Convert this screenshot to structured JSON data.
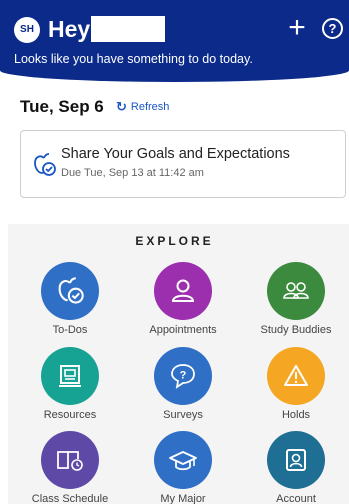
{
  "header": {
    "avatar_initials": "SH",
    "greeting": "Hey",
    "subtitle": "Looks like you have something to do today.",
    "add_icon": "plus-icon",
    "help_icon": "help-icon",
    "bg_color": "#0b2a8a"
  },
  "date_row": {
    "date": "Tue, Sep 6",
    "refresh_label": "Refresh",
    "refresh_icon": "refresh-icon"
  },
  "task": {
    "title": "Share Your Goals and Expectations",
    "due": "Due Tue, Sep 13 at 11:42 am",
    "icon": "apple-check-icon"
  },
  "explore": {
    "title": "EXPLORE",
    "tiles": [
      {
        "label": "To-Dos",
        "icon": "apple-check-icon",
        "color": "#2f6fc6"
      },
      {
        "label": "Appointments",
        "icon": "person-icon",
        "color": "#9b2fae"
      },
      {
        "label": "Study Buddies",
        "icon": "people-icon",
        "color": "#3c8a3e"
      },
      {
        "label": "Resources",
        "icon": "monitor-icon",
        "color": "#17a394"
      },
      {
        "label": "Surveys",
        "icon": "question-bubble-icon",
        "color": "#2f6fc6"
      },
      {
        "label": "Holds",
        "icon": "warning-icon",
        "color": "#f5a623"
      },
      {
        "label": "Class Schedule",
        "icon": "book-icon",
        "color": "#5e4aa6"
      },
      {
        "label": "My Major",
        "icon": "graduation-cap-icon",
        "color": "#2f6fc6"
      },
      {
        "label": "Account",
        "icon": "account-card-icon",
        "color": "#1f6e94"
      }
    ]
  }
}
